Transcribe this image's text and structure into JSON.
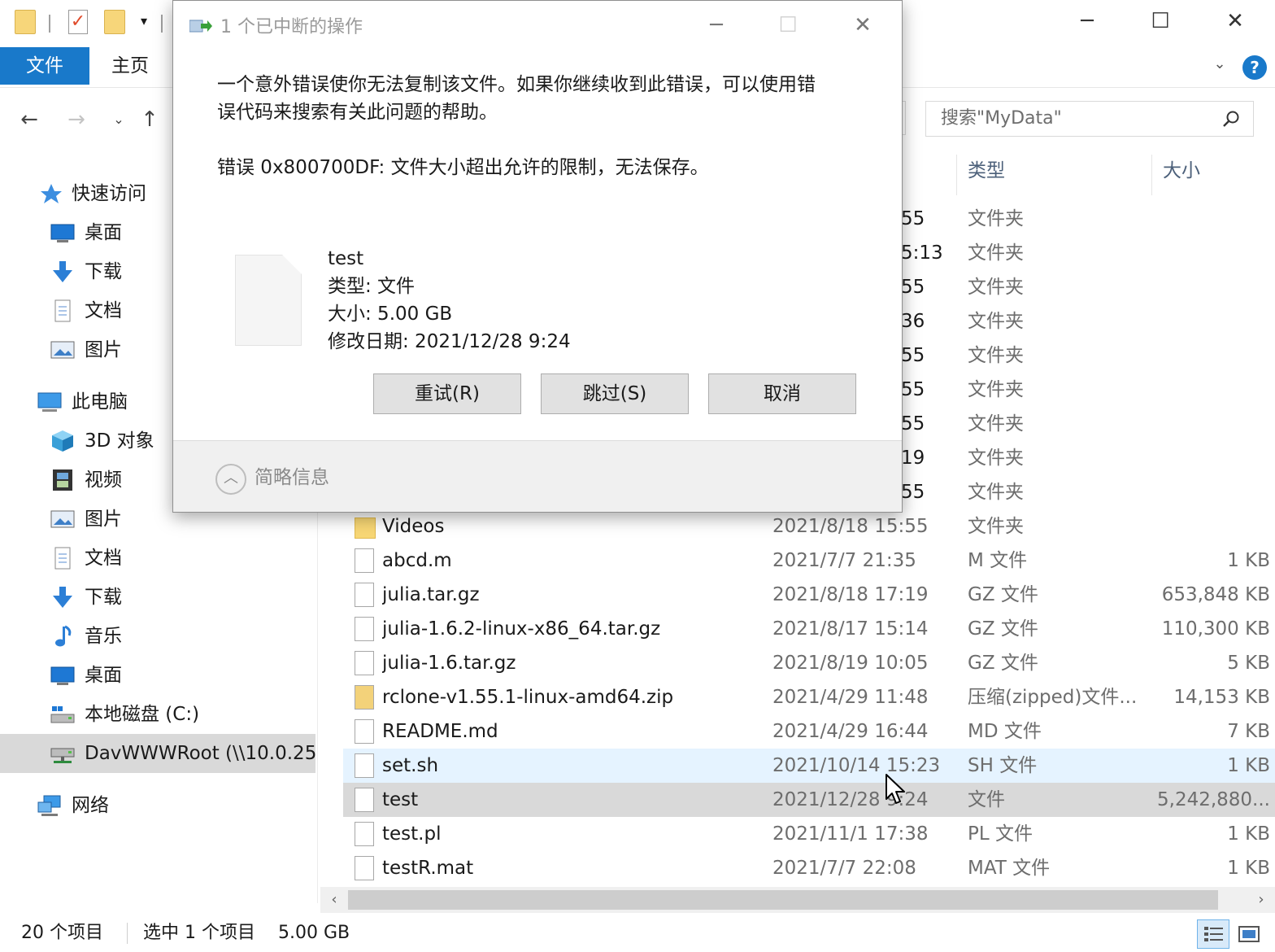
{
  "ribbon": {
    "file_tab": "文件",
    "home_tab": "主页"
  },
  "search": {
    "placeholder": "搜索\"MyData\""
  },
  "sidebar": {
    "items": [
      {
        "label": "快速访问",
        "icon": "pin-icon"
      },
      {
        "label": "桌面",
        "icon": "desktop-icon"
      },
      {
        "label": "下载",
        "icon": "download-arrow-icon"
      },
      {
        "label": "文档",
        "icon": "document-icon"
      },
      {
        "label": "图片",
        "icon": "picture-icon"
      },
      {
        "label": "此电脑",
        "icon": "computer-icon"
      },
      {
        "label": "3D 对象",
        "icon": "cube-icon"
      },
      {
        "label": "视频",
        "icon": "film-icon"
      },
      {
        "label": "图片",
        "icon": "picture-icon"
      },
      {
        "label": "文档",
        "icon": "document-icon"
      },
      {
        "label": "下载",
        "icon": "download-arrow-icon"
      },
      {
        "label": "音乐",
        "icon": "music-note-icon"
      },
      {
        "label": "桌面",
        "icon": "desktop-icon"
      },
      {
        "label": "本地磁盘 (C:)",
        "icon": "local-disk-icon"
      },
      {
        "label": "DavWWWRoot (\\\\10.0.25",
        "icon": "network-drive-icon"
      },
      {
        "label": "网络",
        "icon": "network-icon"
      }
    ]
  },
  "columns": {
    "type": "类型",
    "size": "大小"
  },
  "partial_rows": [
    {
      "date_tail": "55",
      "type": "文件夹"
    },
    {
      "date_tail": "5:13",
      "type": "文件夹"
    },
    {
      "date_tail": "55",
      "type": "文件夹"
    },
    {
      "date_tail": "36",
      "type": "文件夹"
    },
    {
      "date_tail": "55",
      "type": "文件夹"
    },
    {
      "date_tail": "55",
      "type": "文件夹"
    },
    {
      "date_tail": "55",
      "type": "文件夹"
    },
    {
      "date_tail": "19",
      "type": "文件夹"
    },
    {
      "date_tail": "55",
      "type": "文件夹"
    }
  ],
  "files": [
    {
      "name": "Videos",
      "date": "2021/8/18 15:55",
      "type": "文件夹",
      "size": "",
      "icon": "folder-icon"
    },
    {
      "name": "abcd.m",
      "date": "2021/7/7 21:35",
      "type": "M 文件",
      "size": "1 KB",
      "icon": "file-icon"
    },
    {
      "name": "julia.tar.gz",
      "date": "2021/8/18 17:19",
      "type": "GZ 文件",
      "size": "653,848 KB",
      "icon": "file-icon"
    },
    {
      "name": "julia-1.6.2-linux-x86_64.tar.gz",
      "date": "2021/8/17 15:14",
      "type": "GZ 文件",
      "size": "110,300 KB",
      "icon": "file-icon"
    },
    {
      "name": "julia-1.6.tar.gz",
      "date": "2021/8/19 10:05",
      "type": "GZ 文件",
      "size": "5 KB",
      "icon": "file-icon"
    },
    {
      "name": "rclone-v1.55.1-linux-amd64.zip",
      "date": "2021/4/29 11:48",
      "type": "压缩(zipped)文件...",
      "size": "14,153 KB",
      "icon": "zip-icon"
    },
    {
      "name": "README.md",
      "date": "2021/4/29 16:44",
      "type": "MD 文件",
      "size": "7 KB",
      "icon": "file-icon"
    },
    {
      "name": "set.sh",
      "date": "2021/10/14 15:23",
      "type": "SH 文件",
      "size": "1 KB",
      "icon": "file-icon",
      "state": "hover"
    },
    {
      "name": "test",
      "date": "2021/12/28 9:24",
      "type": "文件",
      "size": "5,242,880...",
      "icon": "file-icon",
      "state": "selected"
    },
    {
      "name": "test.pl",
      "date": "2021/11/1 17:38",
      "type": "PL 文件",
      "size": "1 KB",
      "icon": "file-icon"
    },
    {
      "name": "testR.mat",
      "date": "2021/7/7 22:08",
      "type": "MAT 文件",
      "size": "1 KB",
      "icon": "file-icon"
    }
  ],
  "status": {
    "count": "20 个项目",
    "selected": "选中 1 个项目",
    "selected_size": "5.00 GB"
  },
  "dialog": {
    "title": "1 个已中断的操作",
    "message_line1": "一个意外错误使你无法复制该文件。如果你继续收到此错误，可以使用错",
    "message_line2": "误代码来搜索有关此问题的帮助。",
    "error": "错误 0x800700DF: 文件大小超出允许的限制，无法保存。",
    "file_name": "test",
    "file_type": "类型: 文件",
    "file_size": "大小: 5.00 GB",
    "file_modified": "修改日期: 2021/12/28 9:24",
    "retry": "重试(R)",
    "skip": "跳过(S)",
    "cancel": "取消",
    "less_info": "简略信息"
  },
  "colors": {
    "accent": "#1979ca",
    "selection": "#d9d9d9",
    "hover": "#e5f3ff",
    "folder": "#f8d775"
  }
}
